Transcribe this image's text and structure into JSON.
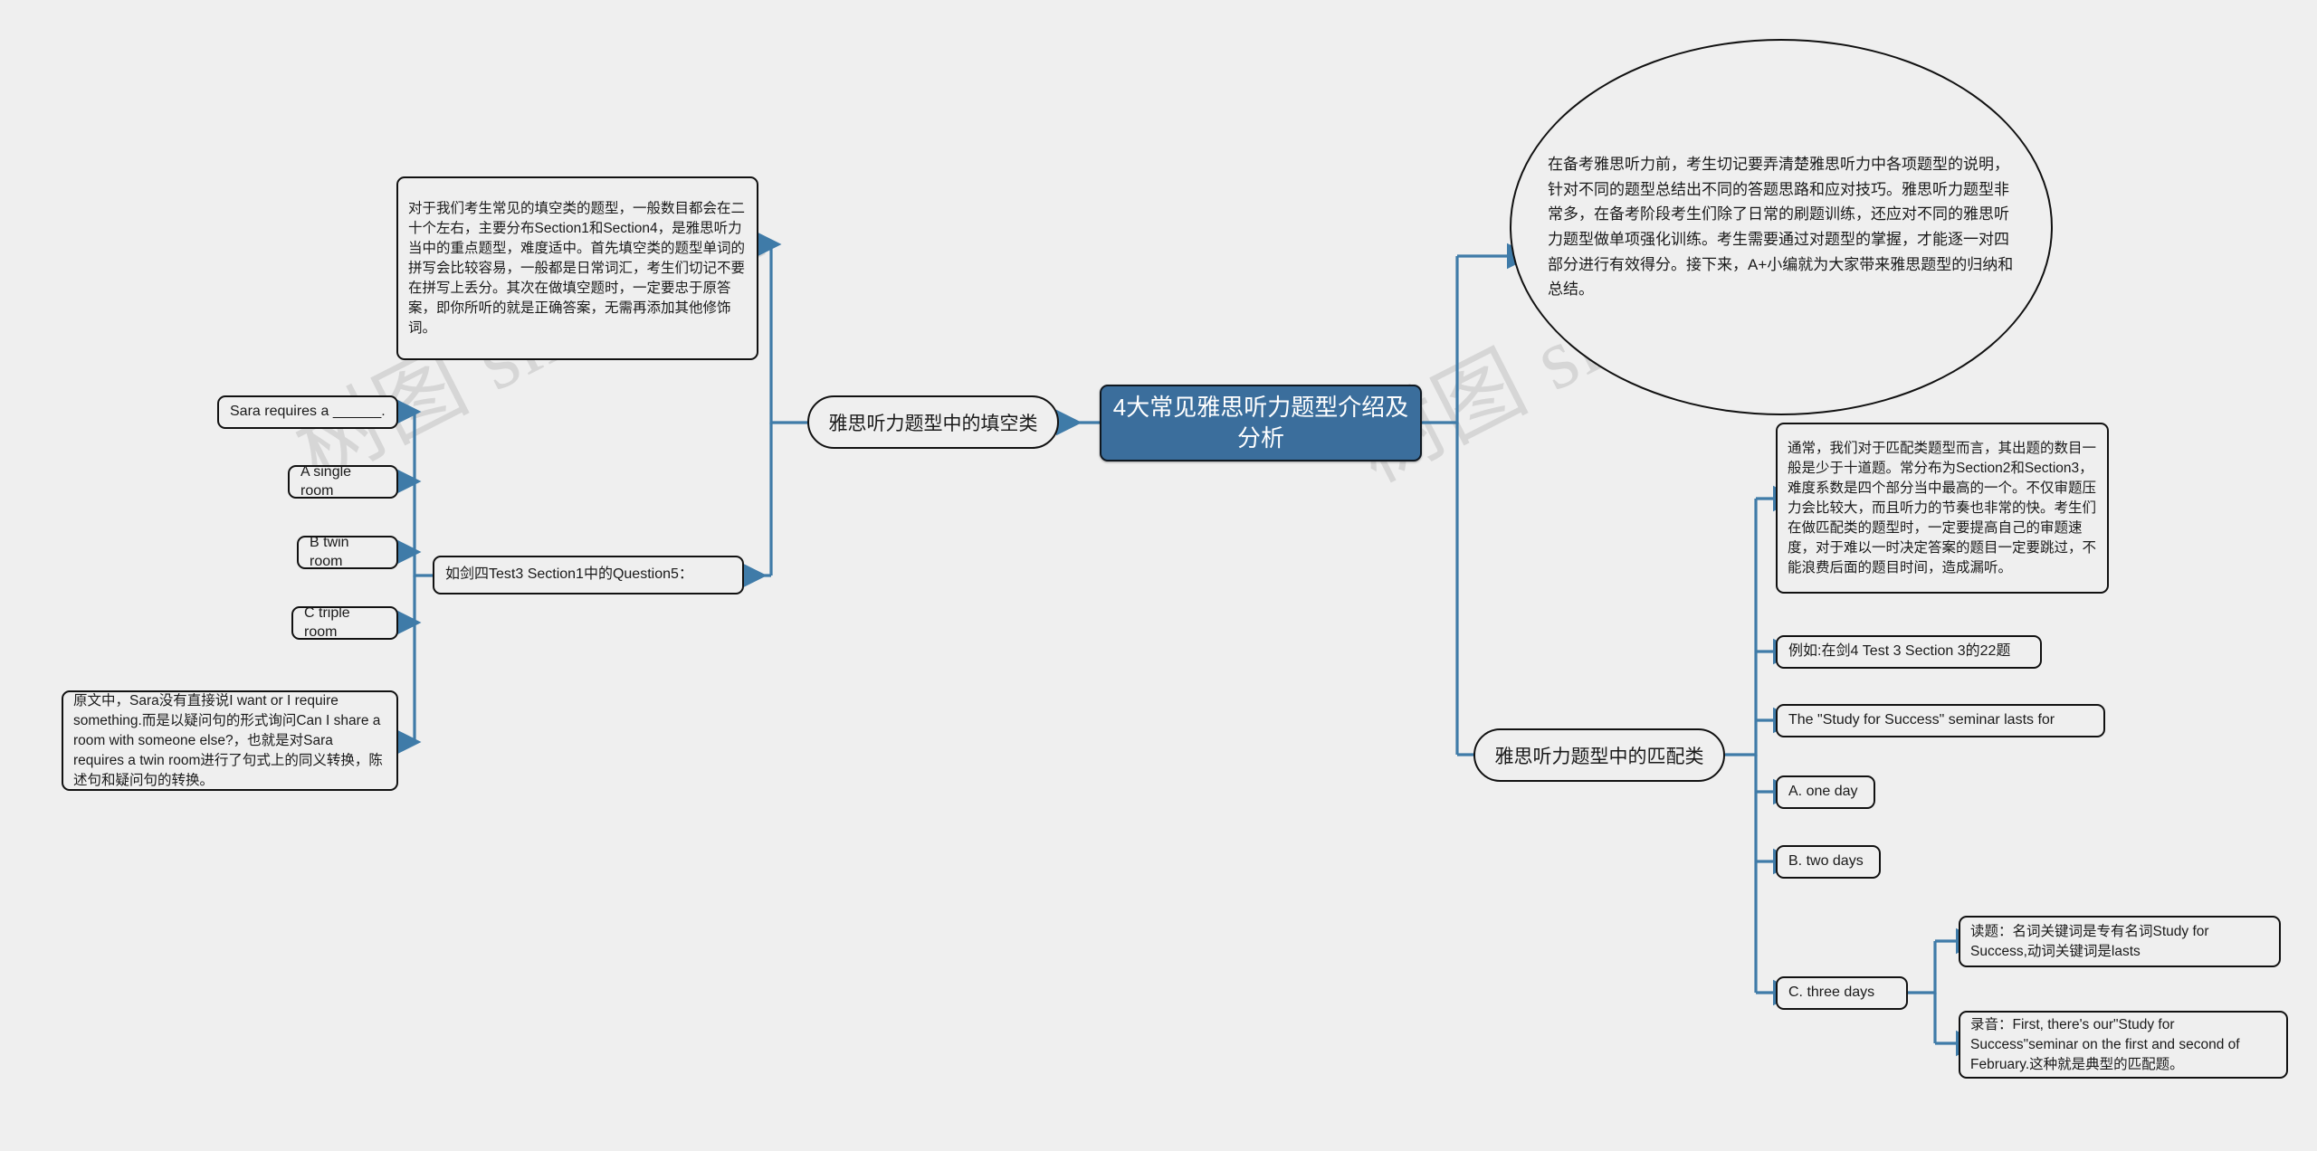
{
  "meta": {
    "background_color": "#efefef",
    "accent_color": "#3b6e9c",
    "connector_color": "#3f7ba8",
    "node_border_color": "#111111",
    "root_text_color": "#ffffff"
  },
  "watermarks": [
    {
      "text": "树图 shutu.cn"
    },
    {
      "text": "树图 shutu.cn"
    }
  ],
  "root": {
    "label": "4大常见雅思听力题型介绍及分析"
  },
  "intro": {
    "label": "在备考雅思听力前，考生切记要弄清楚雅思听力中各项题型的说明，针对不同的题型总结出不同的答题思路和应对技巧。雅思听力题型非常多，在备考阶段考生们除了日常的刷题训练，还应对不同的雅思听力题型做单项强化训练。考生需要通过对题型的掌握，才能逐一对四部分进行有效得分。接下来，A+小编就为大家带来雅思题型的归纳和总结。"
  },
  "branches": [
    {
      "id": "fill-in-blank",
      "label": "雅思听力题型中的填空类",
      "children": [
        {
          "id": "fill-desc",
          "label": "对于我们考生常见的填空类的题型，一般数目都会在二十个左右，主要分布Section1和Section4，是雅思听力当中的重点题型，难度适中。首先填空类的题型单词的拼写会比较容易，一般都是日常词汇，考生们切记不要在拼写上丢分。其次在做填空题时，一定要忠于原答案，即你所听的就是正确答案，无需再添加其他修饰词。"
        },
        {
          "id": "fill-example",
          "label": "如剑四Test3 Section1中的Question5：",
          "children": [
            {
              "id": "q-sara",
              "label": "Sara requires a ______."
            },
            {
              "id": "opt-a-single",
              "label": "A single room"
            },
            {
              "id": "opt-b-twin",
              "label": "B twin room"
            },
            {
              "id": "opt-c-triple",
              "label": "C triple room"
            },
            {
              "id": "fill-analysis",
              "label": "原文中，Sara没有直接说I want or I require something.而是以疑问句的形式询问Can I share a room with someone else?，也就是对Sara requires a twin room进行了句式上的同义转换，陈述句和疑问句的转换。"
            }
          ]
        }
      ]
    },
    {
      "id": "matching",
      "label": "雅思听力题型中的匹配类",
      "children": [
        {
          "id": "match-desc",
          "label": "通常，我们对于匹配类题型而言，其出题的数目一般是少于十道题。常分布为Section2和Section3，难度系数是四个部分当中最高的一个。不仅审题压力会比较大，而且听力的节奏也非常的快。考生们在做匹配类的题型时，一定要提高自己的审题速度，对于难以一时决定答案的题目一定要跳过，不能浪费后面的题目时间，造成漏听。"
        },
        {
          "id": "match-example",
          "label": "例如:在剑4 Test 3 Section 3的22题"
        },
        {
          "id": "match-stem",
          "label": "The \"Study for Success\" seminar lasts for"
        },
        {
          "id": "match-opt-a",
          "label": "A. one day"
        },
        {
          "id": "match-opt-b",
          "label": "B. two days"
        },
        {
          "id": "match-opt-c",
          "label": "C. three days",
          "children": [
            {
              "id": "match-read",
              "label": "读题：名词关键词是专有名词Study for Success,动词关键词是lasts"
            },
            {
              "id": "match-audio",
              "label": "录音：First, there's our\"Study for Success\"seminar on the first and second of February.这种就是典型的匹配题。"
            }
          ]
        }
      ]
    }
  ]
}
